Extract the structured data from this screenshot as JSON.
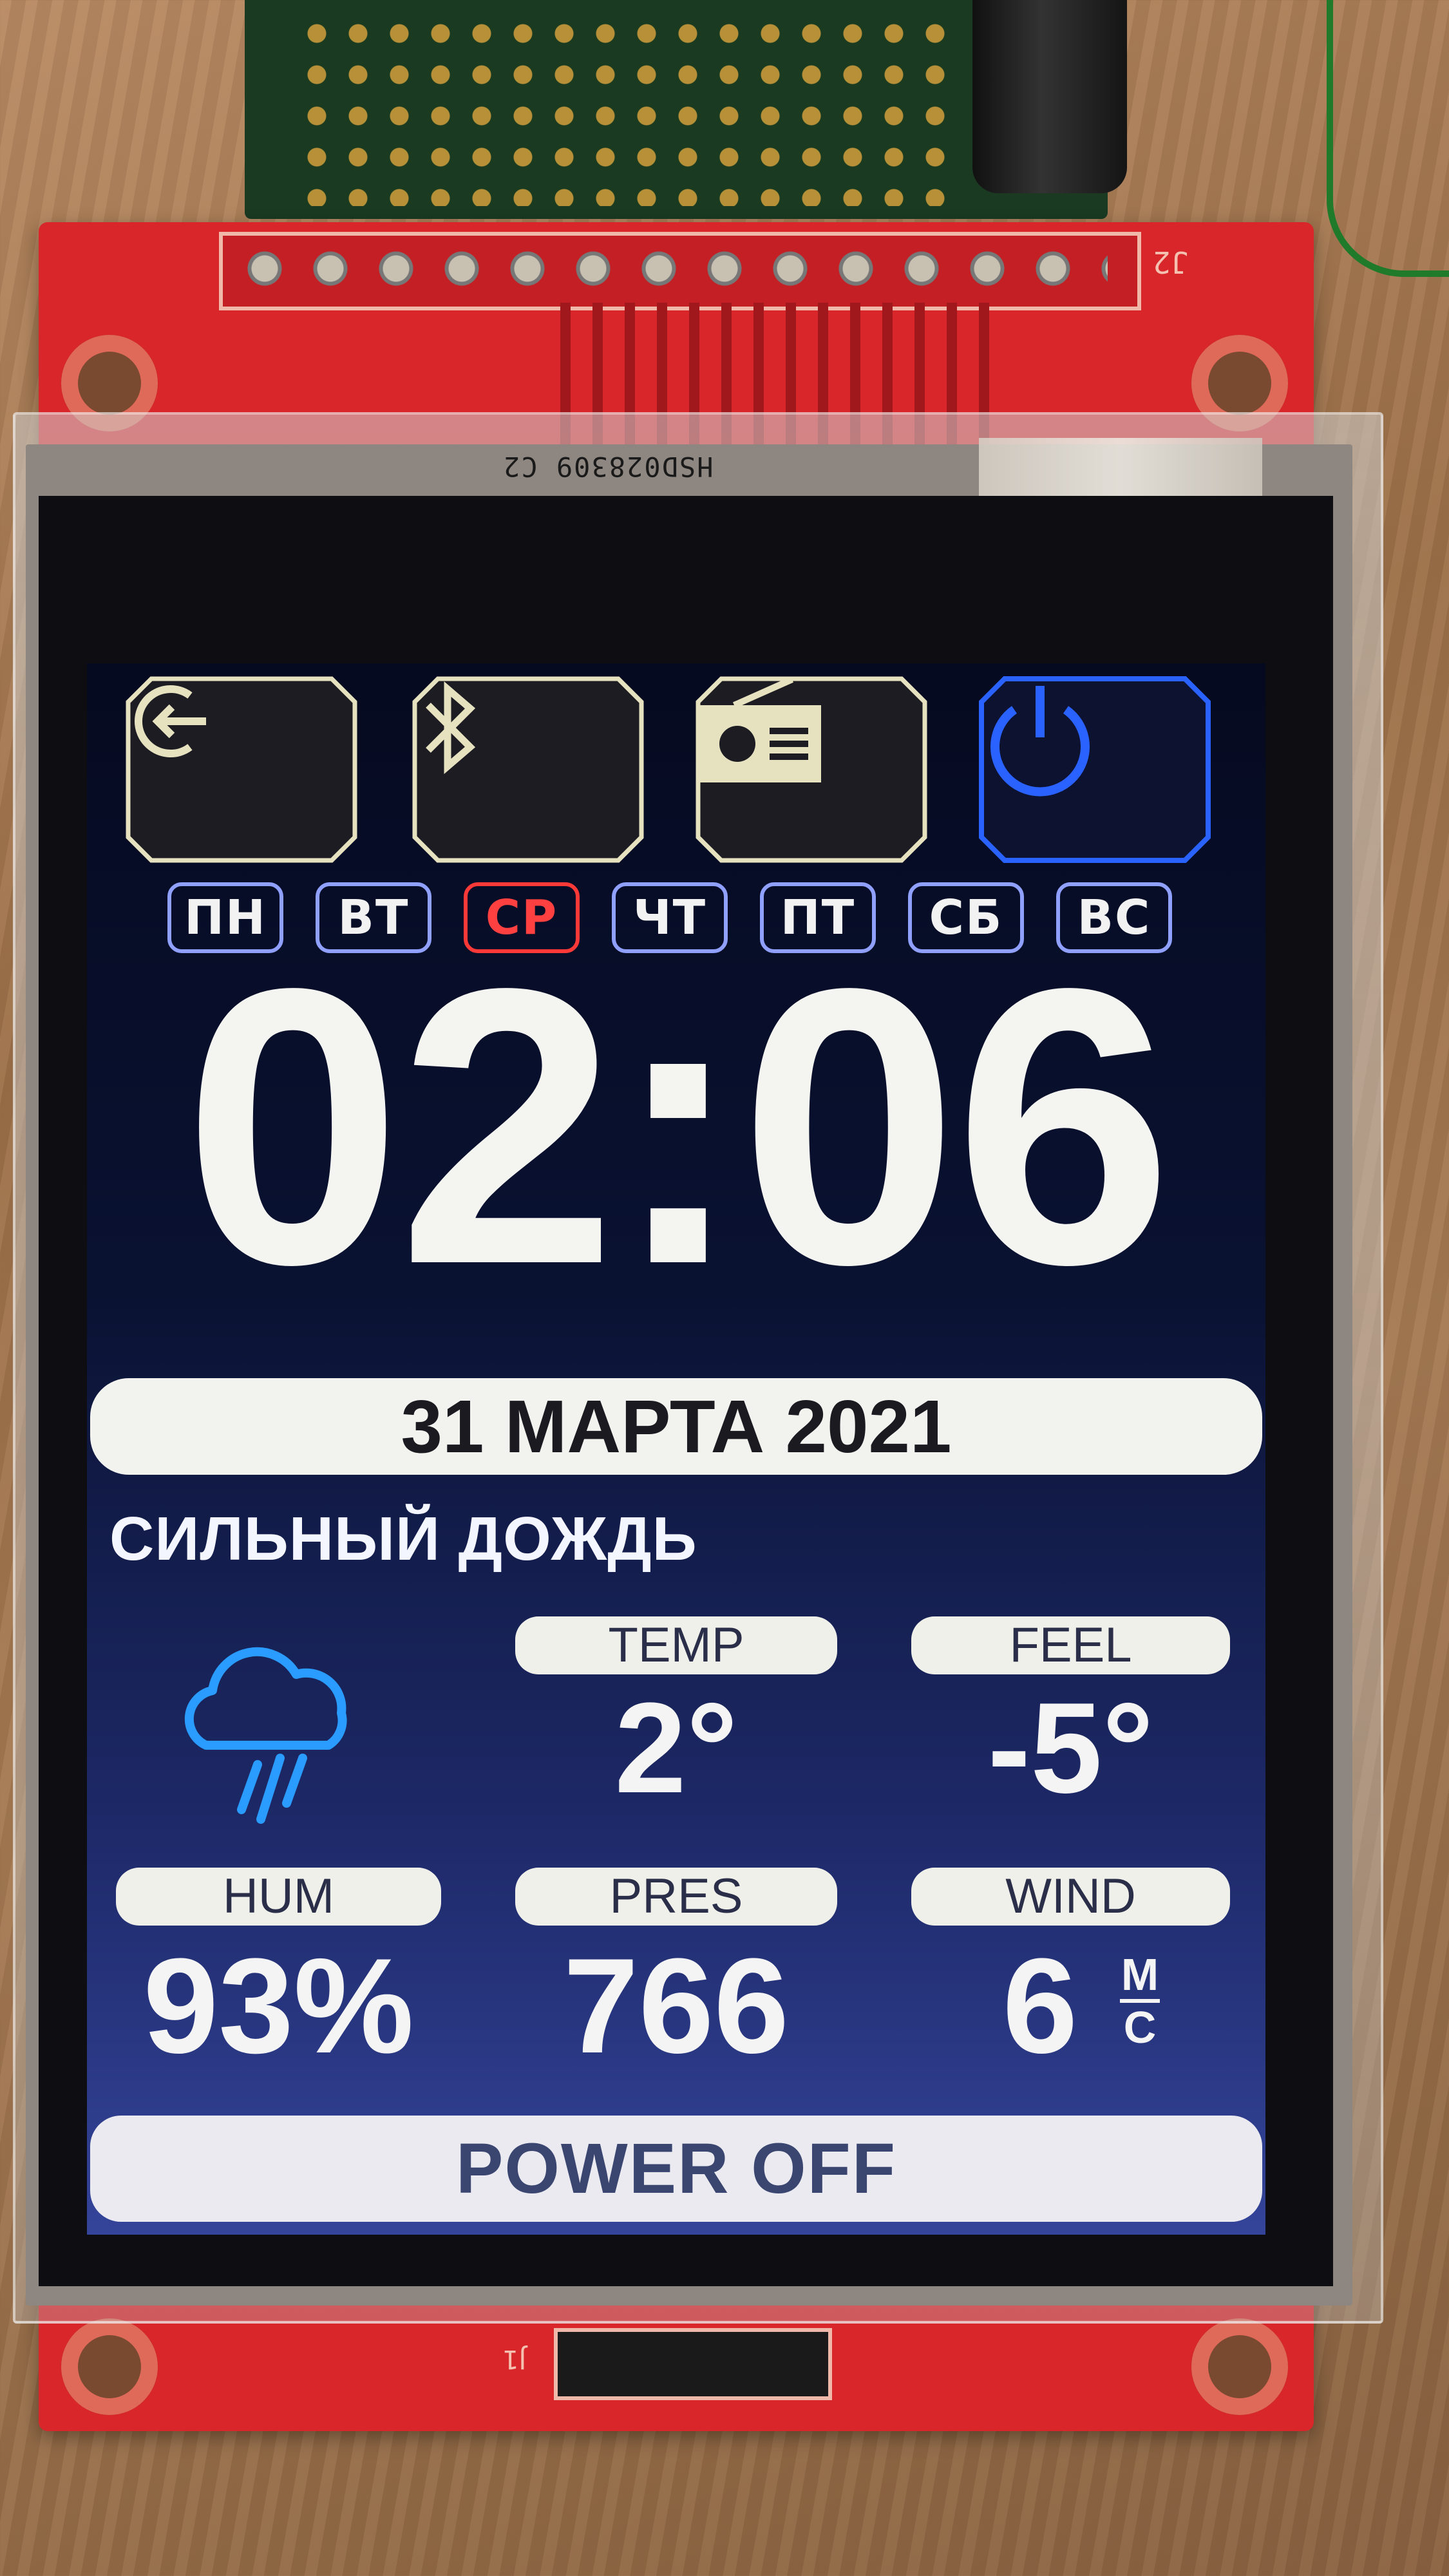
{
  "pcb": {
    "header_label": "J2",
    "bottom_label": "J1",
    "panel_label": "HSD028309 C2"
  },
  "toolbar": {
    "buttons": [
      {
        "icon": "exit-icon",
        "active": false
      },
      {
        "icon": "bluetooth-icon",
        "active": false
      },
      {
        "icon": "radio-icon",
        "active": false
      },
      {
        "icon": "power-icon",
        "active": true
      }
    ],
    "accent_color": "#2a62ff",
    "frame_color": "#e6e2c0"
  },
  "weekdays": {
    "items": [
      "ПН",
      "ВТ",
      "СР",
      "ЧТ",
      "ПТ",
      "СБ",
      "ВС"
    ],
    "current": "СР",
    "current_color": "#ff3838",
    "default_color": "#8fa0ff"
  },
  "clock": {
    "time": "02:06"
  },
  "date": {
    "text": "31 МАРТА 2021"
  },
  "weather": {
    "description": "СИЛЬНЫЙ ДОЖДЬ",
    "icon": "rain-cloud-icon",
    "icon_color": "#2a9cff",
    "temp_label": "TEMP",
    "temp_value": "2°",
    "feel_label": "FEEL",
    "feel_value": "-5°",
    "hum_label": "HUM",
    "hum_value": "93%",
    "pres_label": "PRES",
    "pres_value": "766",
    "wind_label": "WIND",
    "wind_value": "6",
    "wind_unit_top": "М",
    "wind_unit_bottom": "С"
  },
  "footer": {
    "power_label": "POWER OFF"
  }
}
